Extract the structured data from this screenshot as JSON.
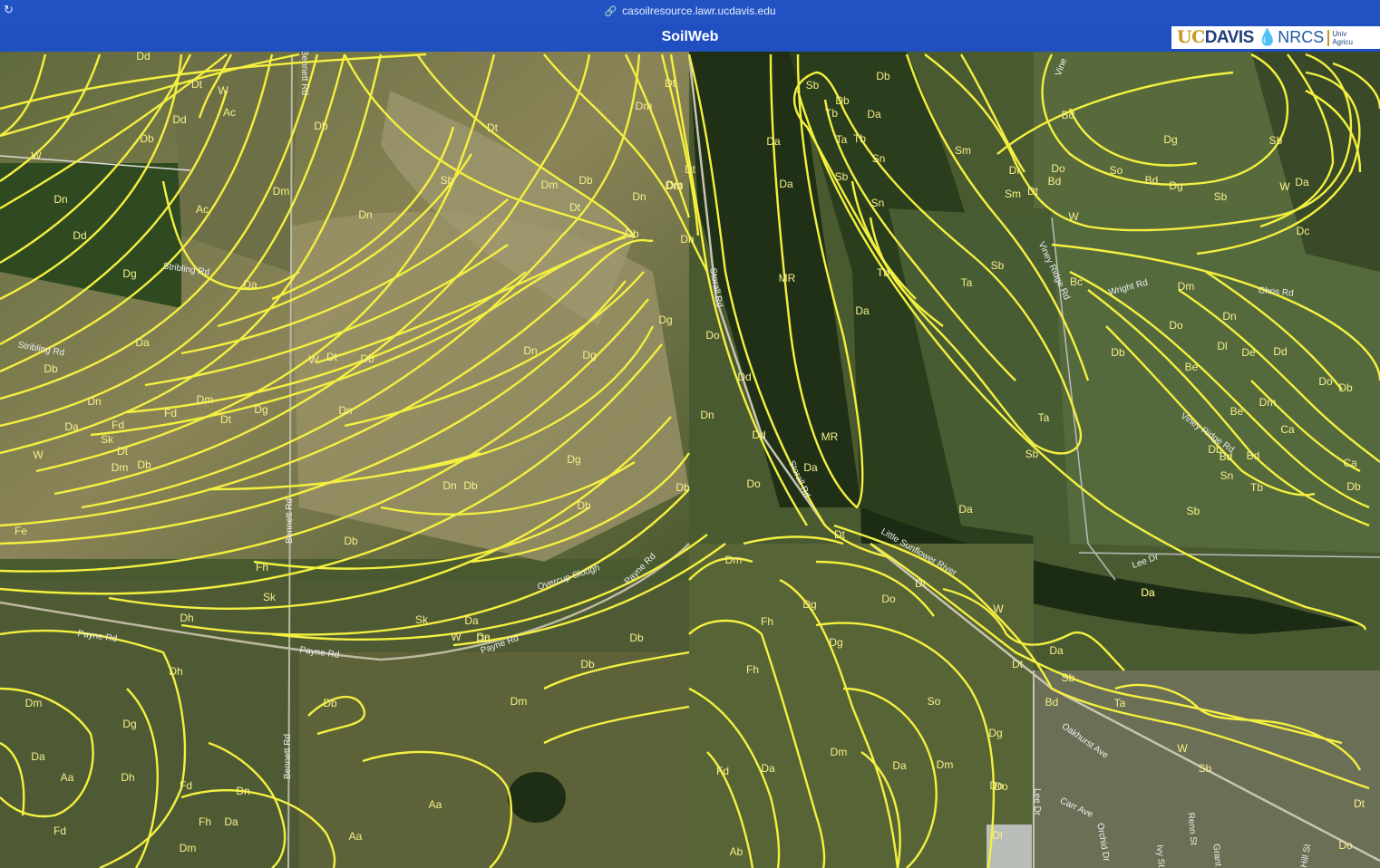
{
  "browser": {
    "url": "casoilresource.lawr.ucdavis.edu",
    "reload_icon": "reload-icon",
    "url_icon": "link-icon"
  },
  "header": {
    "title": "SoilWeb"
  },
  "logos": {
    "ucdavis_uc": "UC",
    "ucdavis_davis": "DAVIS",
    "nrcs": "NRCS",
    "univ_text": "Univ",
    "univ_sub": "Agricu"
  },
  "colors": {
    "polygon_line": "#f4f040",
    "header_bg": "#1f4fc0"
  },
  "soil_units": [
    "Dd",
    "Dt",
    "W",
    "Ac",
    "Dd",
    "Db",
    "W",
    "Dn",
    "Dd",
    "Dg",
    "Da",
    "Ac",
    "Da",
    "Db",
    "Dn",
    "Da",
    "Fd",
    "Sk",
    "Dt",
    "Dm",
    "Db",
    "W",
    "Fe",
    "Fh",
    "Sk",
    "Dh",
    "Dh",
    "Dm",
    "Dg",
    "Da",
    "Aa",
    "Dh",
    "Fd",
    "Dn",
    "Fd",
    "Fh",
    "Da",
    "Dm",
    "Db",
    "Dm",
    "Dn",
    "Dt",
    "Sb",
    "W",
    "Dt",
    "Db",
    "Dm",
    "Fd",
    "Dt",
    "Dg",
    "Dn",
    "Dn",
    "Dn",
    "Db",
    "Dg",
    "Dg",
    "Dn",
    "Db",
    "Db",
    "Dm",
    "Sk",
    "Da",
    "W",
    "Dn",
    "Db",
    "Dm",
    "Db",
    "Dm",
    "Db",
    "Aa",
    "Aa",
    "Dt",
    "Dm",
    "Dm",
    "Db",
    "Dn",
    "Dm",
    "Dt",
    "Dt",
    "Db",
    "Dn",
    "Dg",
    "Do",
    "Dd",
    "Dn",
    "Dd",
    "Da",
    "Do",
    "Db",
    "Dm",
    "Dg",
    "Dg",
    "Fh",
    "Fh",
    "Fd",
    "Da",
    "Dm",
    "Da",
    "Ab",
    "Sb",
    "Db",
    "Tb",
    "Da",
    "Da",
    "Ta",
    "Tb",
    "Sn",
    "Da",
    "Sb",
    "Sn",
    "Tb",
    "MR",
    "Da",
    "MR",
    "Da",
    "Sb",
    "Ta",
    "Ta",
    "Sb",
    "Da",
    "Dt",
    "Do",
    "Dt",
    "W",
    "Sb",
    "Da",
    "Dt",
    "Bd",
    "So",
    "Dm",
    "Dg",
    "Do",
    "Ta",
    "Db",
    "Bd",
    "Dg",
    "Sm",
    "Dr",
    "Do",
    "Bd",
    "Sm",
    "Dt",
    "So",
    "Bd",
    "Dg",
    "Sb",
    "W",
    "Sb",
    "W",
    "Da",
    "Dc",
    "Bc",
    "Dm",
    "Dn",
    "Do",
    "Dl",
    "De",
    "Dd",
    "Db",
    "Be",
    "Dm",
    "Be",
    "Ca",
    "Bd",
    "Db",
    "Sn",
    "Tb",
    "Sb",
    "Da",
    "Do",
    "Db",
    "Ca",
    "Db",
    "Dt",
    "W",
    "Sb",
    "Bd",
    "Dl",
    "Do",
    "Do",
    "Dm",
    "Dm"
  ],
  "road_labels": [
    "Bennett Rd",
    "Bennett Rd",
    "Bennett Rd",
    "Stribling Rd",
    "Stribling Rd",
    "Payne Rd",
    "Payne Rd",
    "Payne Rd",
    "Payne Rd",
    "Overcup Slough",
    "Storall Rd",
    "Storall Rd",
    "Little Sunflower River",
    "Lee Dr",
    "Lee Dr",
    "Oakhurst Ave",
    "Carr Ave",
    "Viney Ridge Rd",
    "Viney Ridge Rd",
    "Vine",
    "Wright Rd",
    "Chris Rd",
    "Orchid Dr",
    "Ivy St",
    "Renn St",
    "Grant St",
    "Hill St"
  ],
  "map_view": {
    "basemap": "satellite imagery",
    "overlay": "soil map unit polygons"
  }
}
